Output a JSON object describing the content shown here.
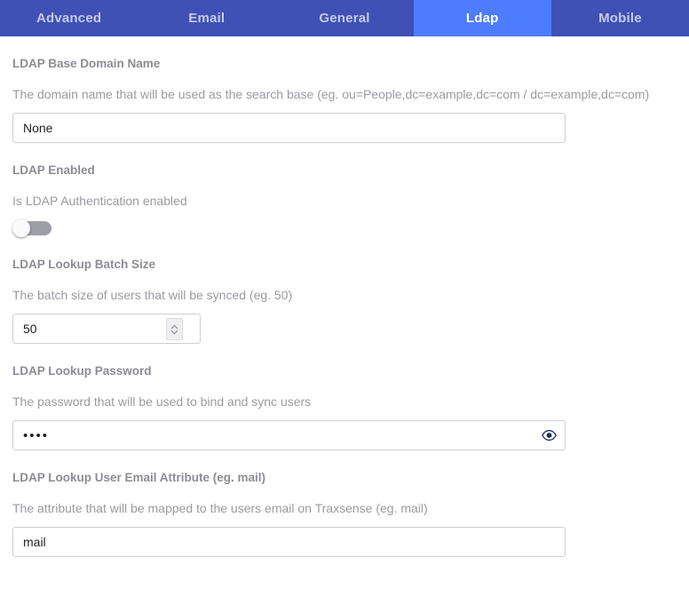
{
  "tabs": [
    {
      "label": "Advanced",
      "active": false
    },
    {
      "label": "Email",
      "active": false
    },
    {
      "label": "General",
      "active": false
    },
    {
      "label": "Ldap",
      "active": true
    },
    {
      "label": "Mobile",
      "active": false
    }
  ],
  "colors": {
    "tabbar_bg": "#3f51b5",
    "tab_active_bg": "#4d7cfe",
    "tab_inactive_text": "#c5cae9",
    "tab_active_text": "#ffffff",
    "label_text": "#8c8c96",
    "desc_text": "#9a9aa2",
    "input_border": "#cfcfd4",
    "input_text": "#20202a",
    "toggle_track_off": "#9e9ea6",
    "toggle_knob": "#fafafa",
    "eye_icon": "#1a2b5e"
  },
  "fields": {
    "base_domain": {
      "label": "LDAP Base Domain Name",
      "description": "The domain name that will be used as the search base (eg. ou=People,dc=example,dc=com / dc=example,dc=com)",
      "value": "None",
      "placeholder": ""
    },
    "enabled": {
      "label": "LDAP Enabled",
      "description": "Is LDAP Authentication enabled",
      "value": "off",
      "icon": "toggle-switch-icon"
    },
    "batch_size": {
      "label": "LDAP Lookup Batch Size",
      "description": "The batch size of users that will be synced (eg. 50)",
      "value": "50",
      "placeholder": "",
      "stepper_up_icon": "chevron-up-icon",
      "stepper_down_icon": "chevron-down-icon"
    },
    "password": {
      "label": "LDAP Lookup Password",
      "description": "The password that will be used to bind and sync users",
      "value": "••••",
      "placeholder": "",
      "reveal_icon": "eye-icon"
    },
    "email_attribute": {
      "label": "LDAP Lookup User Email Attribute (eg. mail)",
      "description": "The attribute that will be mapped to the users email on Traxsense (eg. mail)",
      "value": "mail",
      "placeholder": ""
    }
  }
}
